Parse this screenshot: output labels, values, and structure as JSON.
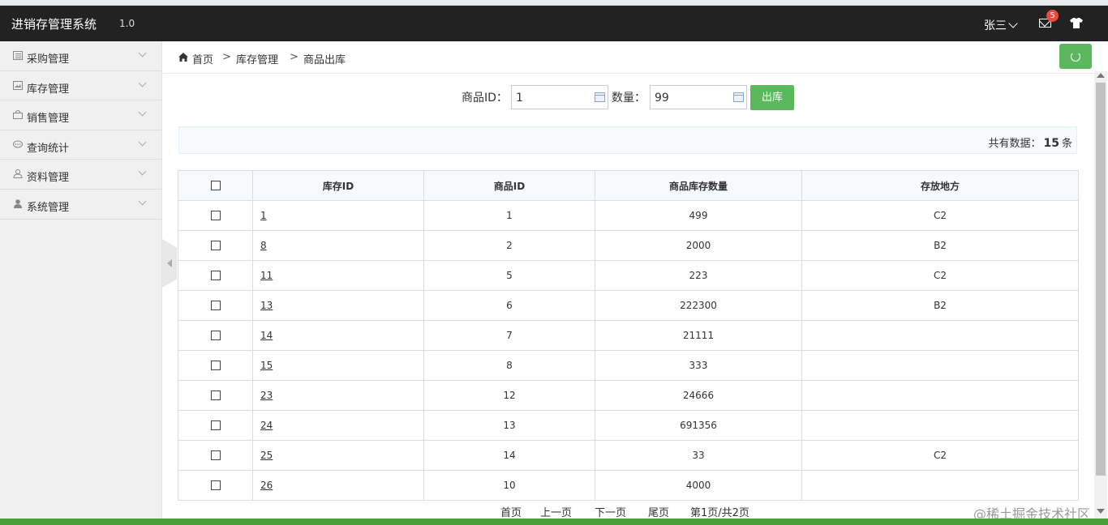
{
  "header": {
    "app_title": "进销存管理系统",
    "version": "1.0",
    "user_name": "张三",
    "mail_badge": "5"
  },
  "sidebar": {
    "items": [
      {
        "label": "采购管理",
        "icon": "list-icon"
      },
      {
        "label": "库存管理",
        "icon": "image-icon"
      },
      {
        "label": "销售管理",
        "icon": "bag-icon"
      },
      {
        "label": "查询统计",
        "icon": "chat-icon"
      },
      {
        "label": "资料管理",
        "icon": "user-outline-icon"
      },
      {
        "label": "系统管理",
        "icon": "user-icon"
      }
    ]
  },
  "breadcrumb": {
    "home": "首页",
    "sep": ">",
    "level1": "库存管理",
    "level2": "商品出库"
  },
  "form": {
    "product_id_label": "商品ID：",
    "product_id_value": "1",
    "quantity_label": "数量：",
    "quantity_value": "99",
    "submit_label": "出库"
  },
  "summary": {
    "prefix": "共有数据：",
    "count": "15",
    "suffix": "条"
  },
  "table": {
    "headers": [
      "库存ID",
      "商品ID",
      "商品库存数量",
      "存放地方"
    ],
    "rows": [
      {
        "stock_id": "1",
        "product_id": "1",
        "quantity": "499",
        "location": "C2"
      },
      {
        "stock_id": "8",
        "product_id": "2",
        "quantity": "2000",
        "location": "B2"
      },
      {
        "stock_id": "11",
        "product_id": "5",
        "quantity": "223",
        "location": "C2"
      },
      {
        "stock_id": "13",
        "product_id": "6",
        "quantity": "222300",
        "location": "B2"
      },
      {
        "stock_id": "14",
        "product_id": "7",
        "quantity": "21111",
        "location": ""
      },
      {
        "stock_id": "15",
        "product_id": "8",
        "quantity": "333",
        "location": ""
      },
      {
        "stock_id": "23",
        "product_id": "12",
        "quantity": "24666",
        "location": ""
      },
      {
        "stock_id": "24",
        "product_id": "13",
        "quantity": "691356",
        "location": ""
      },
      {
        "stock_id": "25",
        "product_id": "14",
        "quantity": "33",
        "location": "C2"
      },
      {
        "stock_id": "26",
        "product_id": "10",
        "quantity": "4000",
        "location": ""
      }
    ]
  },
  "pager": {
    "first": "首页",
    "prev": "上一页",
    "next": "下一页",
    "last": "尾页",
    "info": "第1页/共2页"
  },
  "watermark": "@稀土掘金技术社区",
  "colors": {
    "header_bg": "#222222",
    "accent_green": "#5cb85c",
    "badge_red": "#e94b3c"
  }
}
